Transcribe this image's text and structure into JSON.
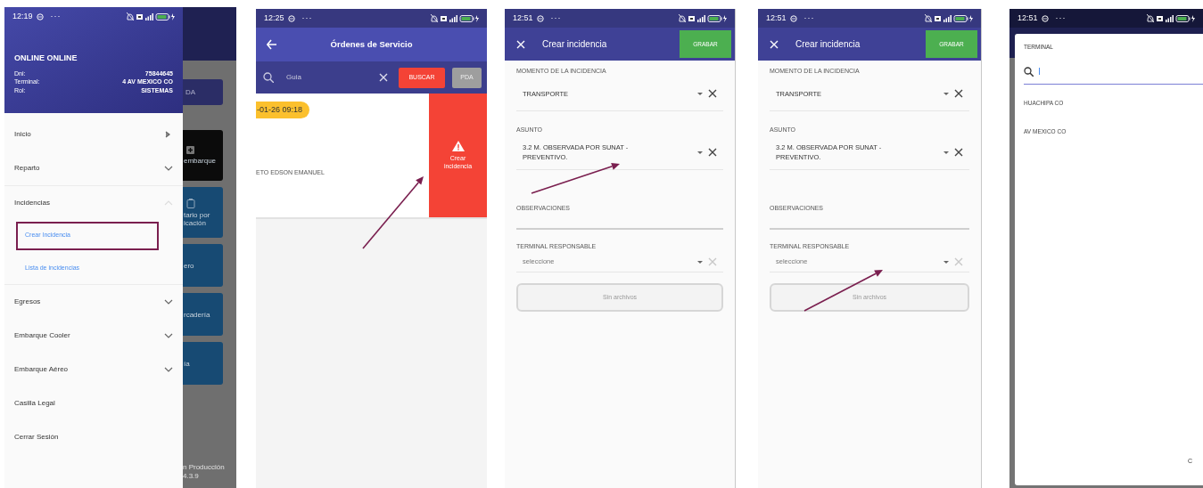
{
  "panels": [
    {
      "kind": "drawer",
      "status_time": "12:19",
      "status_dots": "···",
      "profile": {
        "name": "ONLINE ONLINE",
        "fields": [
          {
            "label": "Dni:",
            "value": "75844645"
          },
          {
            "label": "Terminal:",
            "value": "4 AV MEXICO CO"
          },
          {
            "label": "Rol:",
            "value": "SISTEMAS"
          }
        ]
      },
      "menu": [
        {
          "label": "Inicio",
          "kind": "link"
        },
        {
          "label": "Reparto",
          "kind": "group",
          "expanded": false
        },
        {
          "label": "Incidencias",
          "kind": "group",
          "expanded": true,
          "children": [
            {
              "label": "Crear Incidencia",
              "highlighted": true
            },
            {
              "label": "Lista de incidencias",
              "highlighted": false
            }
          ]
        },
        {
          "label": "Egresos",
          "kind": "group",
          "expanded": false
        },
        {
          "label": "Embarque Cooler",
          "kind": "group",
          "expanded": false
        },
        {
          "label": "Embarque Aéreo",
          "kind": "group",
          "expanded": false
        },
        {
          "label": "Casilla Legal",
          "kind": "link"
        },
        {
          "label": "Cerrar Sesión",
          "kind": "link"
        }
      ],
      "background": {
        "button": "DA",
        "tiles": [
          {
            "label": "embarque",
            "color": "#0b0b0b"
          },
          {
            "label": "tario por icación",
            "color": "#174a73"
          },
          {
            "label": "ero",
            "color": "#174a73"
          },
          {
            "label": "rcadería",
            "color": "#174a73"
          },
          {
            "label": "ía",
            "color": "#174a73"
          }
        ],
        "footer": "n Producción 4.3.9"
      }
    },
    {
      "kind": "orders",
      "status_time": "12:25",
      "status_dots": "···",
      "title": "Órdenes de Servicio",
      "search": {
        "placeholder": "Guia"
      },
      "buttons": [
        {
          "label": "BUSCAR",
          "kind": "primary"
        },
        {
          "label": "PDA",
          "kind": "secondary"
        }
      ],
      "card": {
        "date": "-01-26 09:18",
        "name": "ETO EDSON EMANUEL"
      },
      "swipe_action": {
        "label": "Crear incidencia",
        "pointed": true
      }
    },
    {
      "kind": "form",
      "status_time": "12:51",
      "title": "Crear incidencia",
      "save_button": "GRABAR",
      "status_dots": "···",
      "fields": [
        {
          "label": "MOMENTO DE LA INCIDENCIA",
          "kind": "select",
          "value": "TRANSPORTE",
          "pointed": false
        },
        {
          "label": "ASUNTO",
          "kind": "select",
          "value": "3.2 M. OBSERVADA POR SUNAT - PREVENTIVO.",
          "pointed": true
        },
        {
          "label": "OBSERVACIONES",
          "kind": "text",
          "pointed": false
        },
        {
          "label": "TERMINAL RESPONSABLE",
          "kind": "select",
          "placeholder": "seleccione",
          "pointed": false
        }
      ],
      "attachments": "Sin archivos"
    },
    {
      "kind": "form",
      "status_time": "12:51",
      "title": "Crear incidencia",
      "save_button": "GRABAR",
      "status_dots": "···",
      "fields": [
        {
          "label": "MOMENTO DE LA INCIDENCIA",
          "kind": "select",
          "value": "TRANSPORTE",
          "pointed": false
        },
        {
          "label": "ASUNTO",
          "kind": "select",
          "value": "3.2 M. OBSERVADA POR SUNAT - PREVENTIVO.",
          "pointed": false
        },
        {
          "label": "OBSERVACIONES",
          "kind": "text",
          "pointed": false
        },
        {
          "label": "TERMINAL RESPONSABLE",
          "kind": "select",
          "placeholder": "seleccione",
          "pointed": true
        }
      ],
      "attachments": "Sin archivos"
    },
    {
      "kind": "picker",
      "status_time": "12:51",
      "status_dots": "···",
      "title": "TERMINAL",
      "options": [
        "HUACHIPA CO",
        "AV MEXICO CO"
      ],
      "footer_button": "C"
    }
  ]
}
